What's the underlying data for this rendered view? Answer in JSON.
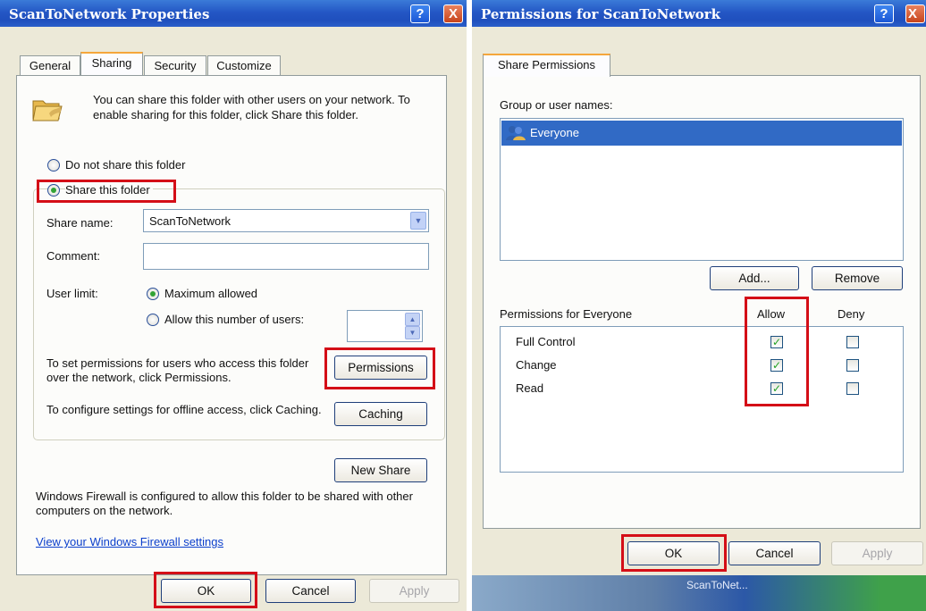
{
  "left": {
    "title": "ScanToNetwork Properties",
    "help_label": "?",
    "close_label": "X",
    "tabs": [
      "General",
      "Sharing",
      "Security",
      "Customize"
    ],
    "intro": "You can share this folder with other users on your network.  To enable sharing for this folder, click Share this folder.",
    "opt_no_share": "Do not share this folder",
    "opt_share": "Share this folder",
    "share_name_label": "Share name:",
    "share_name_value": "ScanToNetwork",
    "comment_label": "Comment:",
    "comment_value": "",
    "user_limit_label": "User limit:",
    "opt_max": "Maximum allowed",
    "opt_allow_n": "Allow this number of users:",
    "perm_text": "To set permissions for users who access this folder over the network, click Permissions.",
    "perm_button": "Permissions",
    "cache_text": "To configure settings for offline access, click Caching.",
    "cache_button": "Caching",
    "new_share_button": "New Share",
    "firewall_text": "Windows Firewall is configured to allow this folder to be shared with other computers on the network.",
    "firewall_link": "View your Windows Firewall settings",
    "ok": "OK",
    "cancel": "Cancel",
    "apply": "Apply"
  },
  "right": {
    "title": "Permissions for ScanToNetwork",
    "help_label": "?",
    "tab": "Share Permissions",
    "group_label": "Group or user names:",
    "users": [
      "Everyone"
    ],
    "add_button": "Add...",
    "remove_button": "Remove",
    "perm_header": "Permissions for Everyone",
    "allow_header": "Allow",
    "deny_header": "Deny",
    "permissions": [
      {
        "name": "Full Control",
        "allow": true,
        "deny": false
      },
      {
        "name": "Change",
        "allow": true,
        "deny": false
      },
      {
        "name": "Read",
        "allow": true,
        "deny": false
      }
    ],
    "check_glyph": "✓",
    "ok": "OK",
    "cancel": "Cancel",
    "apply": "Apply"
  },
  "taskbar_fragment": "ScanToNet..."
}
